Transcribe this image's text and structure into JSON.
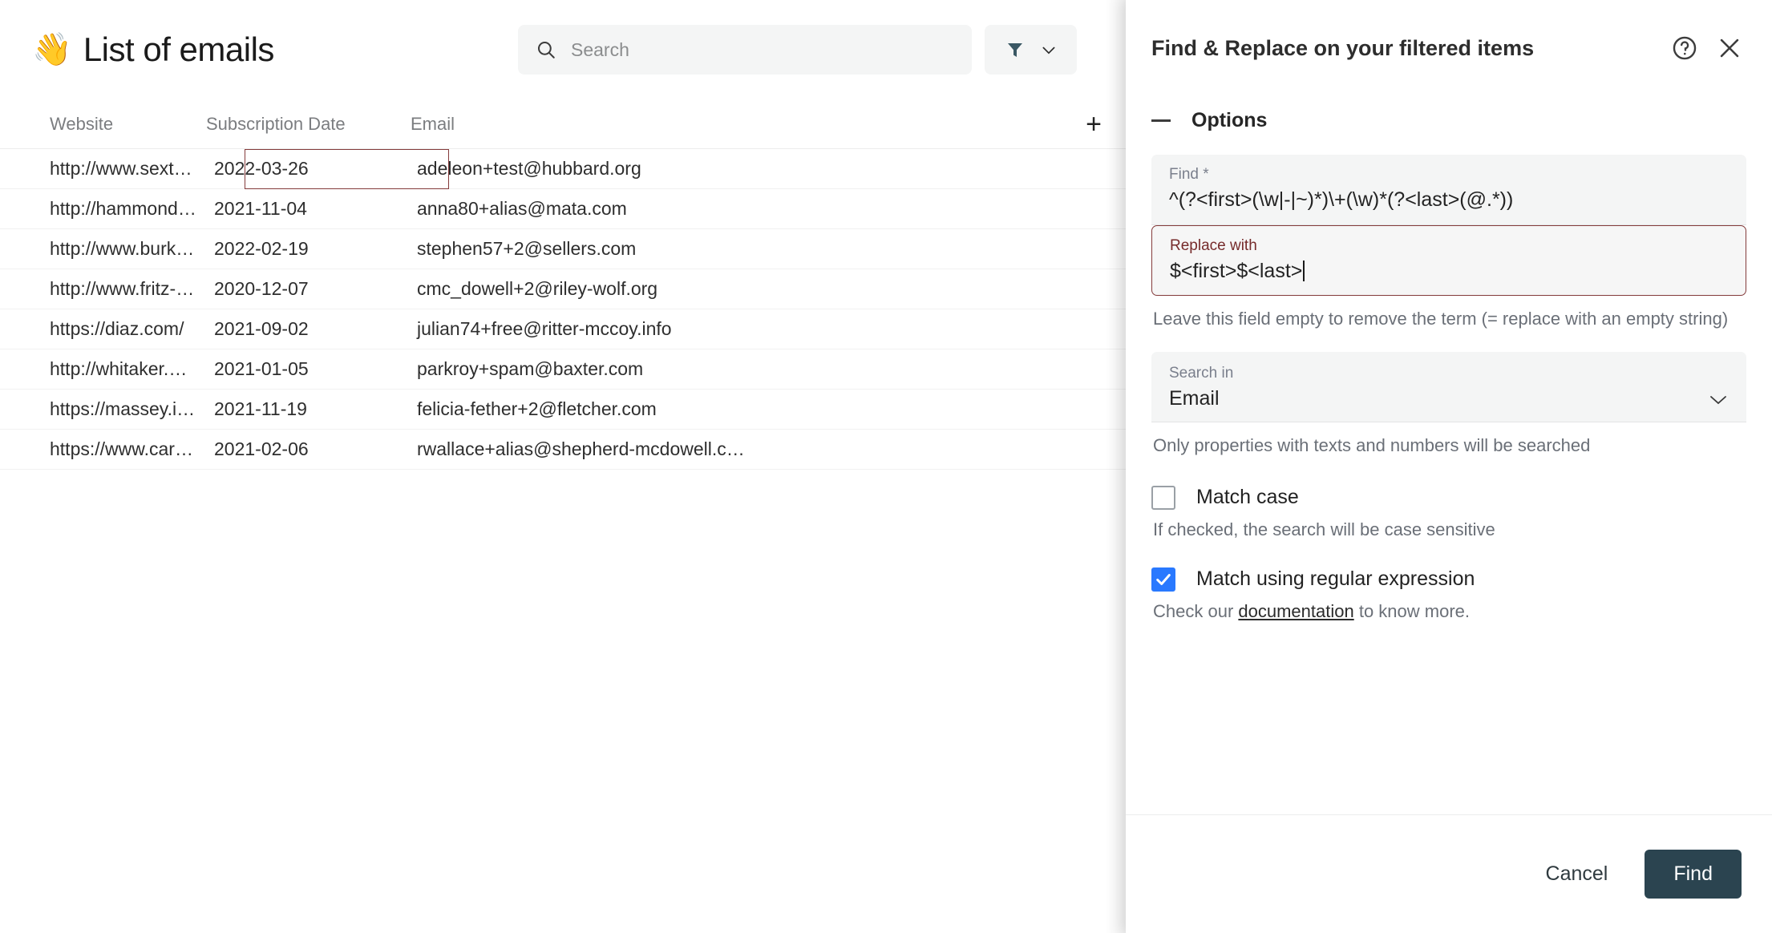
{
  "header": {
    "emoji": "👋",
    "title": "List of emails",
    "search_placeholder": "Search",
    "search_value": "",
    "search_icon": "search-icon",
    "filter_icon": "funnel-icon",
    "filter_chevron": "chevron-down-icon",
    "filter_color": "#3a5864"
  },
  "table": {
    "columns": [
      "Website",
      "Subscription Date",
      "Email"
    ],
    "add_column_label": "+",
    "selected_cell": {
      "row": 0,
      "column": "Subscription Date",
      "value": "2022-03-26",
      "border_color": "#843b3b"
    },
    "rows": [
      {
        "website": "http://www.sexton-chang.c…",
        "date": "2022-03-26",
        "email": "adeleon+test@hubbard.org"
      },
      {
        "website": "http://hammond.com/",
        "date": "2021-11-04",
        "email": "anna80+alias@mata.com"
      },
      {
        "website": "http://www.burke-glover.co…",
        "date": "2022-02-19",
        "email": "stephen57+2@sellers.com"
      },
      {
        "website": "http://www.fritz-galloway.co…",
        "date": "2020-12-07",
        "email": "cmc_dowell+2@riley-wolf.org"
      },
      {
        "website": "https://diaz.com/",
        "date": "2021-09-02",
        "email": "julian74+free@ritter-mccoy.info"
      },
      {
        "website": "http://whitaker.biz/",
        "date": "2021-01-05",
        "email": "parkroy+spam@baxter.com"
      },
      {
        "website": "https://massey.info/",
        "date": "2021-11-19",
        "email": "felicia-fether+2@fletcher.com"
      },
      {
        "website": "https://www.carlson.com/",
        "date": "2021-02-06",
        "email": "rwallace+alias@shepherd-mcdowell.c…"
      }
    ]
  },
  "panel": {
    "title": "Find & Replace on your filtered items",
    "help_icon": "help-circle-icon",
    "close_icon": "close-icon",
    "options_section": {
      "collapse_icon": "minus-icon",
      "label": "Options"
    },
    "find_field": {
      "label": "Find *",
      "value": "^(?<first>(\\w|-|~)*)\\+(\\w)*(?<last>(@.*))"
    },
    "replace_field": {
      "label": "Replace with",
      "value": "$<first>$<last>",
      "focused": true,
      "helper": "Leave this field empty to remove the term (= replace with an empty string)"
    },
    "search_in": {
      "label": "Search in",
      "value": "Email",
      "chevron_icon": "chevron-down-icon",
      "helper": "Only properties with texts and numbers will be searched"
    },
    "match_case": {
      "label": "Match case",
      "checked": false,
      "helper": "If checked, the search will be case sensitive"
    },
    "match_regex": {
      "label": "Match using regular expression",
      "checked": true,
      "accent": "#2979ff",
      "helper_prefix": "Check our ",
      "helper_link": "documentation",
      "helper_suffix": " to know more."
    },
    "footer": {
      "cancel_label": "Cancel",
      "find_label": "Find",
      "find_button_color": "#2b4450"
    }
  }
}
